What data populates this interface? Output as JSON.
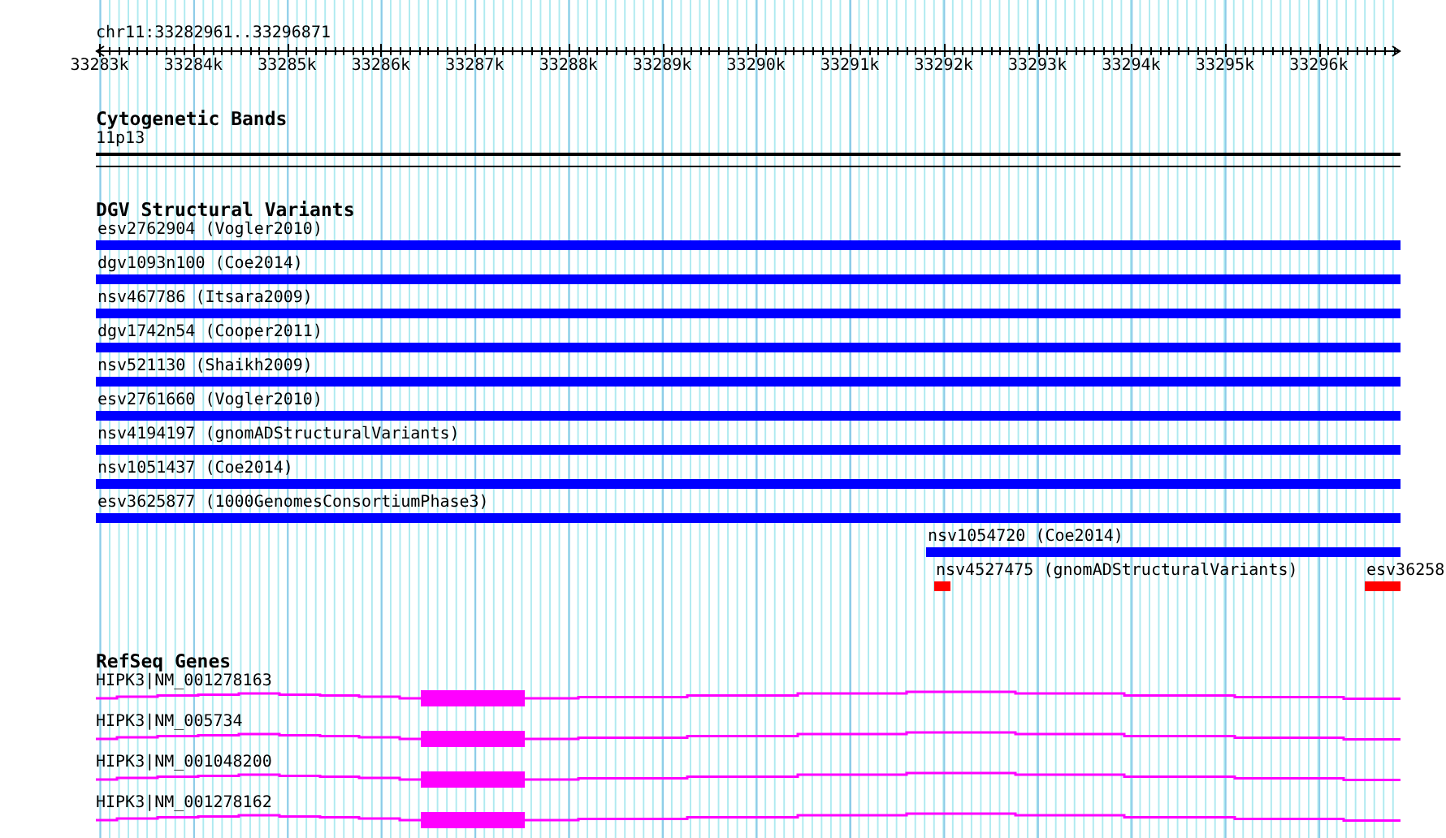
{
  "ruler": {
    "locus": "chr11:33282961..33296871",
    "ticks": [
      "33283k",
      "33284k",
      "33285k",
      "33286k",
      "33287k",
      "33288k",
      "33289k",
      "33290k",
      "33291k",
      "33292k",
      "33293k",
      "33294k",
      "33295k",
      "33296k"
    ]
  },
  "tracks": [
    {
      "kind": "bands",
      "title": "Cytogenetic Bands",
      "features": [
        {
          "label": "11p13"
        }
      ]
    },
    {
      "kind": "variants",
      "title": "DGV Structural Variants",
      "rows": [
        {
          "features": [
            {
              "label": "esv2762904 (Vogler2010)",
              "color": "#0000ff"
            }
          ]
        },
        {
          "features": [
            {
              "label": "dgv1093n100 (Coe2014)",
              "color": "#0000ff"
            }
          ]
        },
        {
          "features": [
            {
              "label": "nsv467786 (Itsara2009)",
              "color": "#0000ff"
            }
          ]
        },
        {
          "features": [
            {
              "label": "dgv1742n54 (Cooper2011)",
              "color": "#0000ff"
            }
          ]
        },
        {
          "features": [
            {
              "label": "nsv521130 (Shaikh2009)",
              "color": "#0000ff"
            }
          ]
        },
        {
          "features": [
            {
              "label": "esv2761660 (Vogler2010)",
              "color": "#0000ff"
            }
          ]
        },
        {
          "features": [
            {
              "label": "nsv4194197 (gnomADStructuralVariants)",
              "color": "#0000ff"
            }
          ]
        },
        {
          "features": [
            {
              "label": "nsv1051437 (Coe2014)",
              "color": "#0000ff"
            }
          ]
        },
        {
          "features": [
            {
              "label": "esv3625877 (1000GenomesConsortiumPhase3)",
              "color": "#0000ff"
            }
          ]
        },
        {
          "features": [
            {
              "label": "nsv1054720 (Coe2014)",
              "color": "#0000ff"
            }
          ]
        },
        {
          "features": [
            {
              "label": "nsv4527475 (gnomADStructuralVariants)",
              "color": "#ff0000"
            },
            {
              "label": "esv36258",
              "color": "#ff0000"
            }
          ]
        }
      ]
    },
    {
      "kind": "genes",
      "title": "RefSeq Genes",
      "features": [
        {
          "label": "HIPK3|NM_001278163"
        },
        {
          "label": "HIPK3|NM_005734"
        },
        {
          "label": "HIPK3|NM_001048200"
        },
        {
          "label": "HIPK3|NM_001278162"
        }
      ]
    }
  ]
}
